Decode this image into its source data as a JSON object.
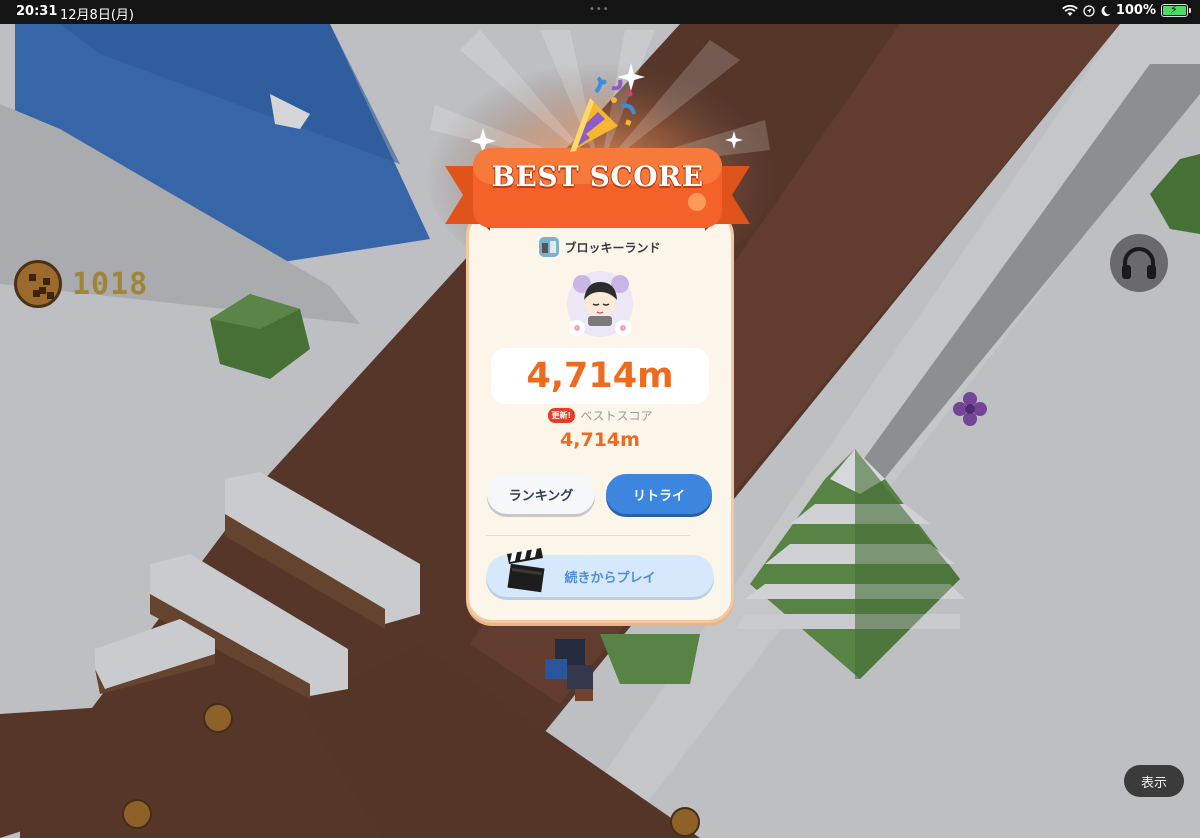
{
  "status_bar": {
    "time": "20:31",
    "date": "12月8日(月)",
    "battery_percent": "100%",
    "icons": [
      "wifi-icon",
      "location-icon",
      "moon-icon",
      "battery-charging-icon"
    ]
  },
  "hud": {
    "coin_count": "1018",
    "coin_icon": "cookie-icon",
    "audio_icon": "headphones-icon",
    "display_button_label": "表示"
  },
  "dialog": {
    "banner_title": "BEST SCORE",
    "app_name": "ブロッキーランド",
    "score": "4,714m",
    "new_badge": "更新!",
    "best_label": "ベストスコア",
    "best_value": "4,714m",
    "ranking_button": "ランキング",
    "retry_button": "リトライ",
    "continue_button": "続きからプレイ"
  },
  "colors": {
    "banner_orange": "#f4622a",
    "score_orange": "#ee6a1f",
    "retry_blue": "#3d86e0",
    "continue_blue": "#d6e8fb"
  }
}
